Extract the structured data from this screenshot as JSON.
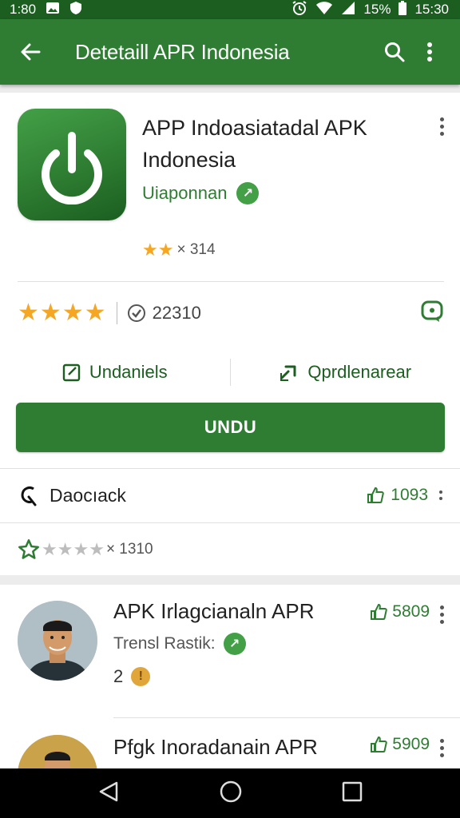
{
  "status_bar": {
    "time_left": "1:80",
    "battery_pct": "15%",
    "time_right": "15:30"
  },
  "app_bar": {
    "title": "Detetaill APR Indonesia",
    "back_icon": "arrow-left-icon",
    "search_icon": "search-icon",
    "menu_icon": "more-vert-icon"
  },
  "app": {
    "title": "APP Indoasiatadal APK Indonesia",
    "developer": "Uiaponnan",
    "small_rating_text": "× 314",
    "small_rating_stars": 2,
    "rating_stars": 4,
    "review_count": "22310",
    "action_left": "Undaniels",
    "action_right": "Qprdlenarear",
    "install_label": "UNDU"
  },
  "rows": {
    "feedback_label": "Daocıack",
    "feedback_count": "1093",
    "rating_count": "× 1310",
    "rating_stars": 1
  },
  "list": [
    {
      "title": "APK Irlagcianaln APR",
      "sub": "Trensl Rastik:",
      "meta": "2",
      "count": "5809"
    },
    {
      "title": "Pfgk Inoradanain APR",
      "count": "5909"
    }
  ],
  "colors": {
    "primary": "#2e7d32",
    "primary_dark": "#1b5e20",
    "star": "#f5a623"
  }
}
